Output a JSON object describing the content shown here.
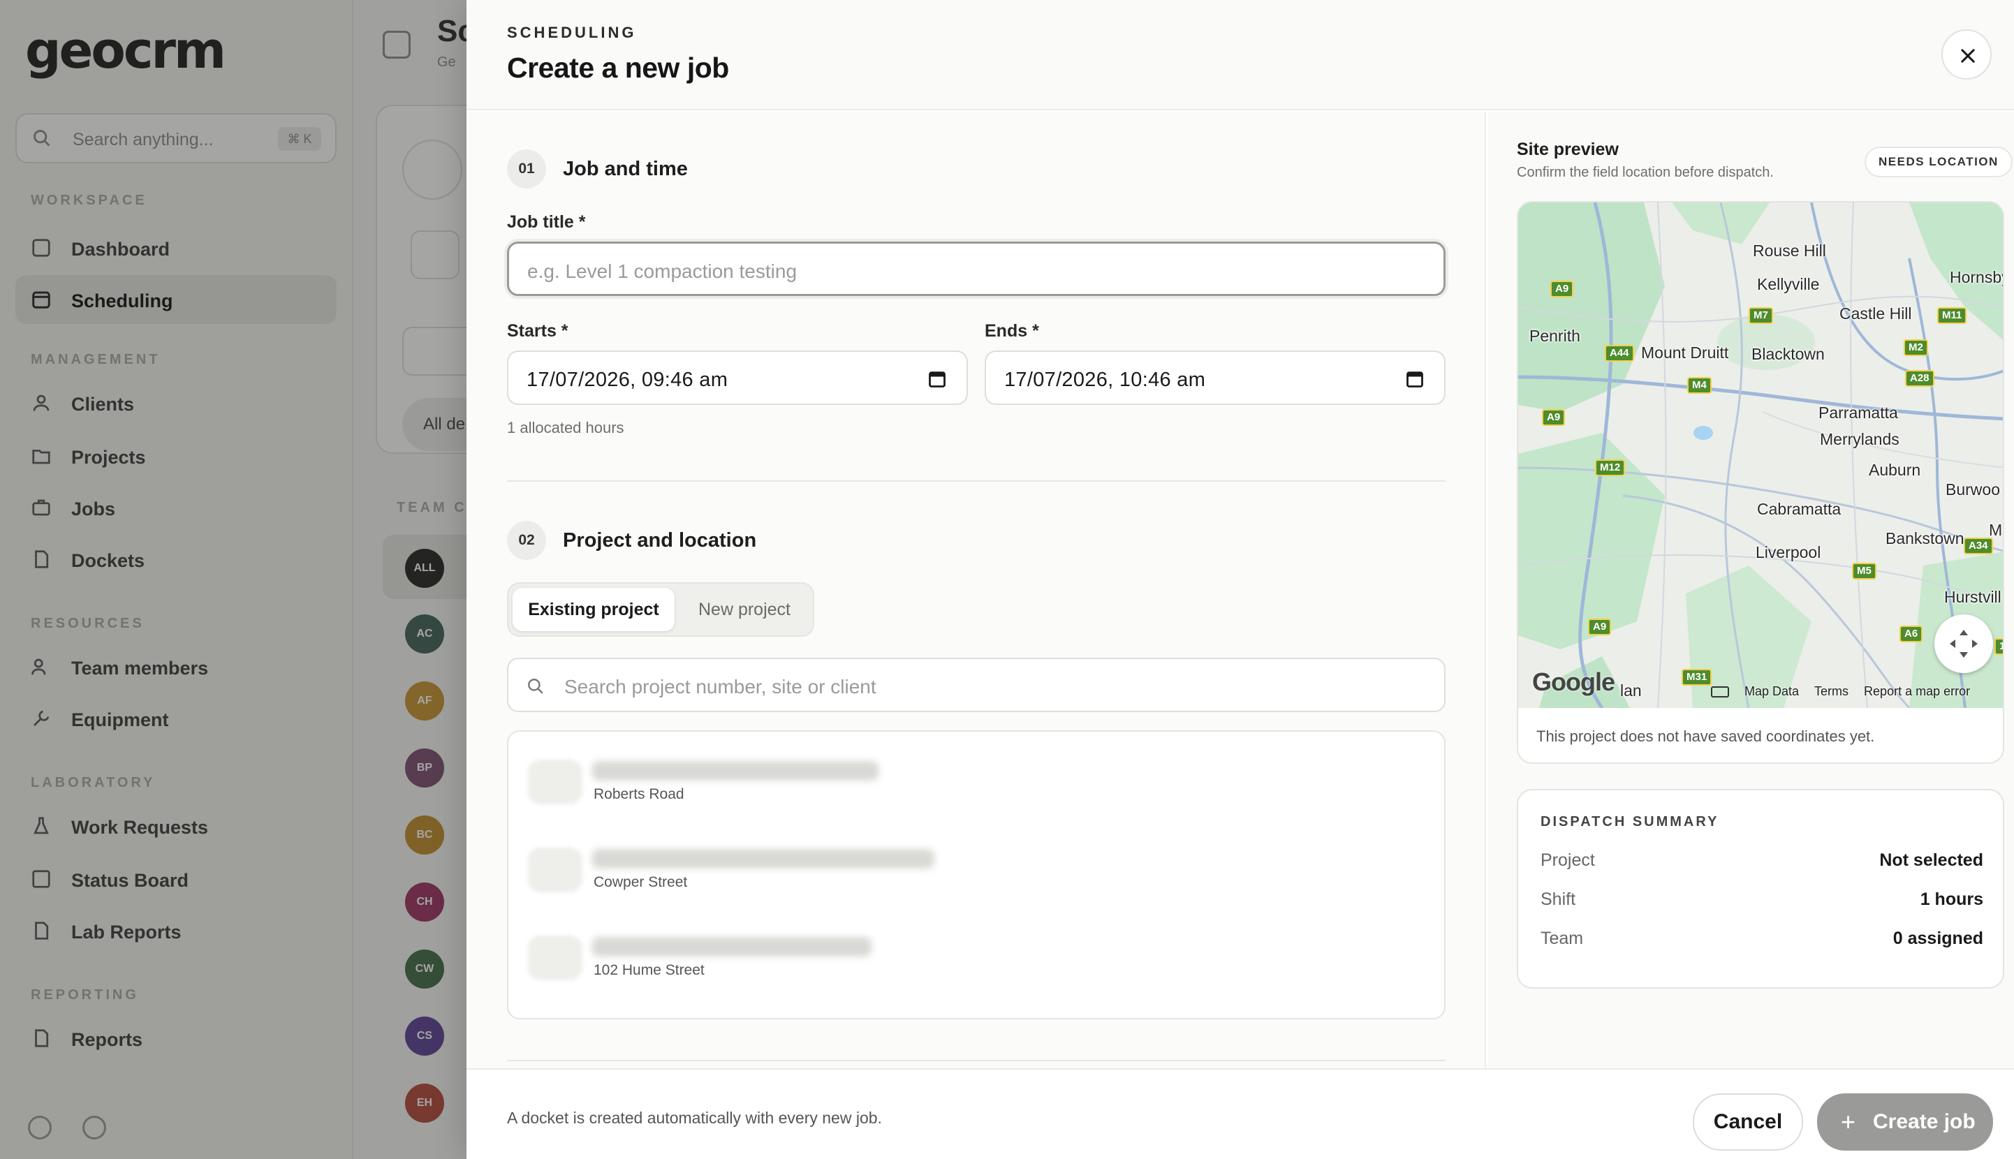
{
  "app": {
    "logo": "geocrm",
    "search_placeholder": "Search anything...",
    "search_shortcut": "⌘ K",
    "sections": [
      {
        "title": "WORKSPACE",
        "items": [
          "Dashboard",
          "Scheduling"
        ]
      },
      {
        "title": "MANAGEMENT",
        "items": [
          "Clients",
          "Projects",
          "Jobs",
          "Dockets"
        ]
      },
      {
        "title": "RESOURCES",
        "items": [
          "Team members",
          "Equipment"
        ]
      },
      {
        "title": "LABORATORY",
        "items": [
          "Work Requests",
          "Status Board",
          "Lab Reports"
        ]
      },
      {
        "title": "REPORTING",
        "items": [
          "Reports"
        ]
      }
    ],
    "active_item": "Scheduling",
    "page_title": "Sc",
    "page_subtitle": "Ge",
    "filter_pill": "All de",
    "team_heading": "TEAM CA",
    "team_avatars": [
      {
        "initials": "ALL",
        "color": "#222222"
      },
      {
        "initials": "AC",
        "color": "#3f5f57"
      },
      {
        "initials": "AF",
        "color": "#c8932e"
      },
      {
        "initials": "BP",
        "color": "#7a4a6e"
      },
      {
        "initials": "BC",
        "color": "#c08a28"
      },
      {
        "initials": "CH",
        "color": "#9a2f5e"
      },
      {
        "initials": "CW",
        "color": "#3e6a44"
      },
      {
        "initials": "CS",
        "color": "#5b3e94"
      },
      {
        "initials": "EH",
        "color": "#b2453a"
      }
    ]
  },
  "drawer": {
    "eyebrow": "SCHEDULING",
    "title": "Create a new job",
    "step1": {
      "number": "01",
      "title": "Job and time"
    },
    "job_title": {
      "label": "Job title *",
      "placeholder": "e.g. Level 1 compaction testing",
      "value": ""
    },
    "starts": {
      "label": "Starts *",
      "value": "17/07/2026, 09:46 am"
    },
    "ends": {
      "label": "Ends *",
      "value": "17/07/2026, 10:46 am"
    },
    "allocated_hint": "1 allocated hours",
    "step2": {
      "number": "02",
      "title": "Project and location"
    },
    "project_mode": {
      "options": [
        "Existing project",
        "New project"
      ],
      "selected": "Existing project"
    },
    "project_search_placeholder": "Search project number, site or client",
    "project_results": [
      {
        "street": "Roberts Road"
      },
      {
        "street": "Cowper Street"
      },
      {
        "street": "102 Hume Street"
      }
    ],
    "footer_note": "A docket is created automatically with every new job.",
    "cancel_label": "Cancel",
    "create_label": "Create job"
  },
  "site_preview": {
    "title": "Site preview",
    "subtitle": "Confirm the field location before dispatch.",
    "status_badge": "NEEDS LOCATION",
    "map_note": "This project does not have saved coordinates yet.",
    "map": {
      "suburbs": [
        "Rouse Hill",
        "Kellyville",
        "Hornsby",
        "Castle Hill",
        "Penrith",
        "Mount Druitt",
        "Blacktown",
        "Parramatta",
        "Merrylands",
        "Auburn",
        "Burwoo",
        "Cabramatta",
        "Bankstown",
        "M",
        "Liverpool",
        "Hurstvill",
        "lan"
      ],
      "roads": [
        "A9",
        "M7",
        "M11",
        "A44",
        "M4",
        "M2",
        "A28",
        "A9",
        "M12",
        "A34",
        "M5",
        "A9",
        "A6",
        "M31",
        "1"
      ],
      "attribution_logo": "Google",
      "links": [
        "Map Data",
        "Terms",
        "Report a map error"
      ]
    }
  },
  "dispatch_summary": {
    "heading": "DISPATCH SUMMARY",
    "rows": [
      {
        "key": "Project",
        "value": "Not selected"
      },
      {
        "key": "Shift",
        "value": "1 hours"
      },
      {
        "key": "Team",
        "value": "0 assigned"
      }
    ]
  }
}
